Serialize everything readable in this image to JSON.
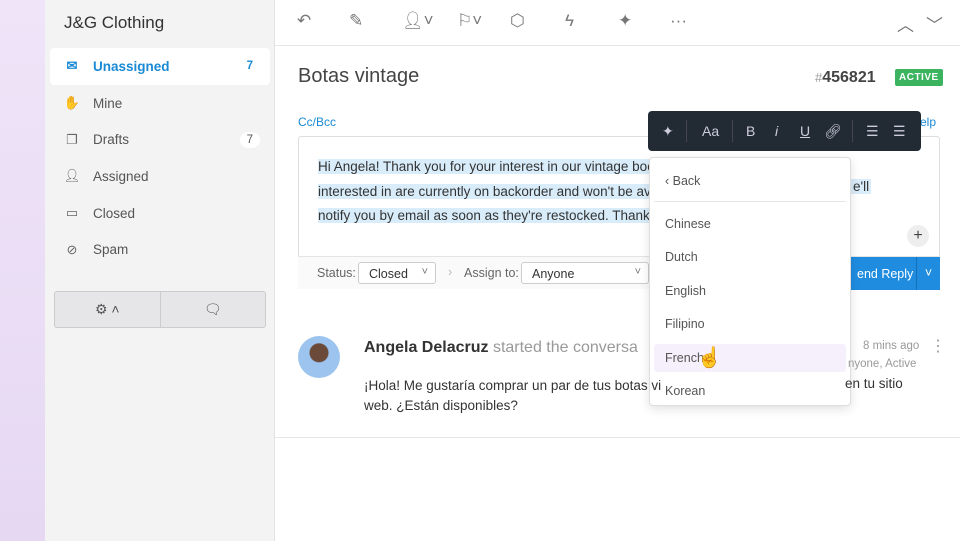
{
  "brand": "J&G Clothing",
  "nav": [
    {
      "label": "Unassigned",
      "count": "7",
      "icon": "inbox-icon"
    },
    {
      "label": "Mine",
      "count": "",
      "icon": "hand-icon"
    },
    {
      "label": "Drafts",
      "count": "7",
      "icon": "drafts-icon"
    },
    {
      "label": "Assigned",
      "count": "",
      "icon": "user-icon"
    },
    {
      "label": "Closed",
      "count": "",
      "icon": "archive-icon"
    },
    {
      "label": "Spam",
      "count": "",
      "icon": "block-icon"
    }
  ],
  "conversation": {
    "title": "Botas vintage",
    "hash": "#",
    "id": "456821",
    "status": "ACTIVE"
  },
  "editor": {
    "cc_bcc": "Cc/Bcc",
    "help": "elp",
    "lines": [
      "Hi Angela! Thank you for your interest in our vintage boot",
      "interested in are currently on backorder and won't be avai",
      "notify you by email as soon as they're restocked. Thank y"
    ],
    "line2_tail": "e'll",
    "status_label": "Status:",
    "status_value": "Closed",
    "assign_label": "Assign to:",
    "assign_value": "Anyone",
    "send": "end Reply"
  },
  "format_toolbar": {
    "text_size": "Aa",
    "bold": "B",
    "italic": "i",
    "underline": "U"
  },
  "language_menu": {
    "back": "Back",
    "items": [
      "Chinese",
      "Dutch",
      "English",
      "Filipino",
      "French",
      "Korean"
    ],
    "hovered": "French"
  },
  "message": {
    "author": "Angela Delacruz",
    "action": "started the conversa",
    "time": "8 mins ago",
    "meta": "nyone, Active",
    "body": "¡Hola! Me gustaría comprar un par de tus botas vi",
    "body_line2": "web. ¿Están disponibles?",
    "body_tail": "en tu sitio"
  }
}
